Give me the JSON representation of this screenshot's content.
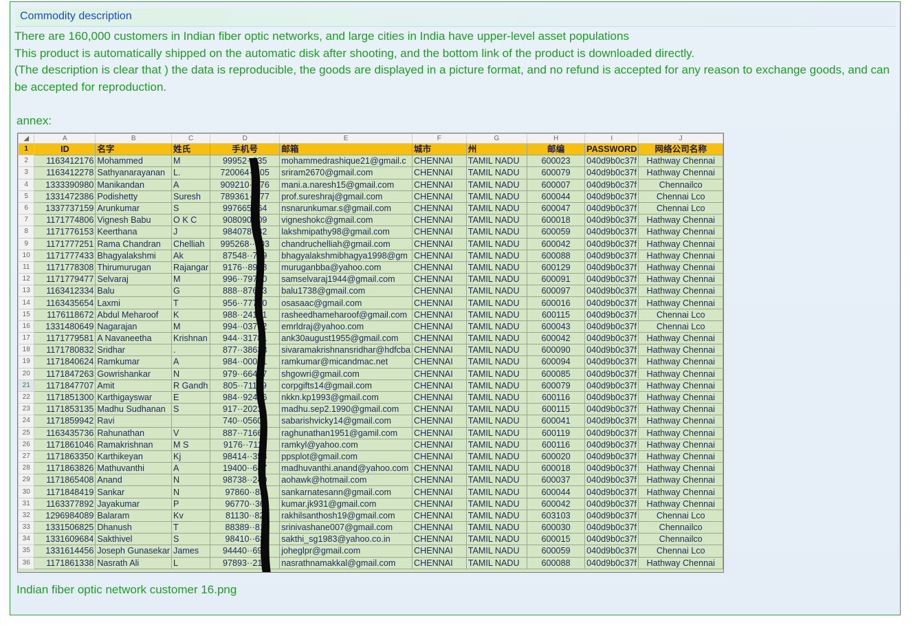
{
  "panel": {
    "title": "Commodity description",
    "description": [
      "There are 160,000 customers in Indian fiber optic networks, and large cities in India have upper-level asset populations",
      "This product is automatically shipped on the automatic disk after shooting, and the bottom link of the product is downloaded directly.",
      "(The description is clear that ) the data is reproducible, the goods are displayed in a picture format, and no refund is accepted for any reason to exchange goods, and can be accepted for reproduction."
    ],
    "annex_label": "annex:",
    "image_caption": "Indian fiber optic network customer 16.png"
  },
  "spreadsheet": {
    "corner": "◢",
    "column_letters": [
      "A",
      "B",
      "C",
      "D",
      "E",
      "F",
      "G",
      "H",
      "I",
      "J"
    ],
    "header_row_number": "1",
    "headers": [
      "ID",
      "名字",
      "姓氏",
      "手机号",
      "邮箱",
      "城市",
      "州",
      "邮编",
      "PASSWORD",
      "网络公司名称"
    ],
    "selected_row": "21",
    "rows": [
      [
        "2",
        "1163412176",
        "Mohammed",
        "M",
        "99952··035",
        "mohammedrashique21@gmail.c",
        "CHENNAI",
        "TAMIL NADU",
        "600023",
        "040d9b0c37f",
        "Hathway Chennai"
      ],
      [
        "3",
        "1163412278",
        "Sathyanarayanan",
        "L.",
        "720064··405",
        "sriram2670@gmail.com",
        "CHENNAI",
        "TAMIL NADU",
        "600079",
        "040d9b0c37f",
        "Hathway Chennai"
      ],
      [
        "4",
        "1333390980",
        "Manikandan",
        "A",
        "909210··976",
        "mani.a.naresh15@gmail.com",
        "CHENNAI",
        "TAMIL NADU",
        "600007",
        "040d9b0c37f",
        "Chennailco"
      ],
      [
        "5",
        "1331472386",
        "Podishetty",
        "Suresh",
        "789361··577",
        "prof.sureshraj@gmail.com",
        "CHENNAI",
        "TAMIL NADU",
        "600044",
        "040d9b0c37f",
        "Chennai Lco"
      ],
      [
        "6",
        "1337737159",
        "Arunkumar",
        "S",
        "997665··64",
        "nsnarunkumar.s@gmail.com",
        "CHENNAI",
        "TAMIL NADU",
        "600047",
        "040d9b0c37f",
        "Chennai Lco"
      ],
      [
        "7",
        "1171774806",
        "Vignesh Babu",
        "O K C",
        "908090··09",
        "vigneshokc@gmail.com",
        "CHENNAI",
        "TAMIL NADU",
        "600018",
        "040d9b0c37f",
        "Hathway Chennai"
      ],
      [
        "8",
        "1171776153",
        "Keerthana",
        "J",
        "984078··82",
        "lakshmipathy98@gmail.com",
        "CHENNAI",
        "TAMIL NADU",
        "600059",
        "040d9b0c37f",
        "Hathway Chennai"
      ],
      [
        "9",
        "1171777251",
        "Rama Chandran",
        "Chelliah",
        "995268··703",
        "chandruchelliah@gmail.com",
        "CHENNAI",
        "TAMIL NADU",
        "600042",
        "040d9b0c37f",
        "Hathway Chennai"
      ],
      [
        "10",
        "1171777433",
        "Bhagyalakshmi",
        "Ak",
        "87548··799",
        "bhagyalakshmibhagya1998@gm",
        "CHENNAI",
        "TAMIL NADU",
        "600088",
        "040d9b0c37f",
        "Hathway Chennai"
      ],
      [
        "11",
        "1171778308",
        "Thirumurugan",
        "Rajangar",
        "9176··8998",
        "muruganbba@yahoo.com",
        "CHENNAI",
        "TAMIL NADU",
        "600129",
        "040d9b0c37f",
        "Hathway Chennai"
      ],
      [
        "12",
        "1171779477",
        "Selvaraj",
        "M",
        "996··79710",
        "samselvaraj1944@gmail.com",
        "CHENNAI",
        "TAMIL NADU",
        "600091",
        "040d9b0c37f",
        "Hathway Chennai"
      ],
      [
        "13",
        "1163412334",
        "Balu",
        "G",
        "888··87683",
        "balu1738@gmail.com",
        "CHENNAI",
        "TAMIL NADU",
        "600097",
        "040d9b0c37f",
        "Hathway Chennai"
      ],
      [
        "14",
        "1163435654",
        "Laxmi",
        "T",
        "956··77730",
        "osasaac@gmail.com",
        "CHENNAI",
        "TAMIL NADU",
        "600016",
        "040d9b0c37f",
        "Hathway Chennai"
      ],
      [
        "15",
        "1176118672",
        "Abdul Meharoof",
        "K",
        "988··24161",
        "rasheedhameharoof@gmail.com",
        "CHENNAI",
        "TAMIL NADU",
        "600115",
        "040d9b0c37f",
        "Chennai Lco"
      ],
      [
        "16",
        "1331480649",
        "Nagarajan",
        "M",
        "994··03752",
        "emrldraj@yahoo.com",
        "CHENNAI",
        "TAMIL NADU",
        "600043",
        "040d9b0c37f",
        "Chennai Lco"
      ],
      [
        "17",
        "1171779581",
        "A Navaneetha",
        "Krishnan",
        "944··31781",
        "ank30august1955@gmail.com",
        "CHENNAI",
        "TAMIL NADU",
        "600042",
        "040d9b0c37f",
        "Hathway Chennai"
      ],
      [
        "18",
        "1171780832",
        "Sridhar",
        ".",
        "877··38633",
        "sivaramakrishnansridhar@hdfcba",
        "CHENNAI",
        "TAMIL NADU",
        "600090",
        "040d9b0c37f",
        "Hathway Chennai"
      ],
      [
        "19",
        "1171840624",
        "Ramkumar",
        "A",
        "984··00071",
        "ramkumar@micandmac.net",
        "CHENNAI",
        "TAMIL NADU",
        "600094",
        "040d9b0c37f",
        "Hathway Chennai"
      ],
      [
        "20",
        "1171847263",
        "Gowrishankar",
        "N",
        "979··66437",
        "shgowri@gmail.com",
        "CHENNAI",
        "TAMIL NADU",
        "600085",
        "040d9b0c37f",
        "Hathway Chennai"
      ],
      [
        "21",
        "1171847707",
        "Amit",
        "R Gandh",
        "805··71199",
        "corpgifts14@gmail.com",
        "CHENNAI",
        "TAMIL NADU",
        "600079",
        "040d9b0c37f",
        "Hathway Chennai"
      ],
      [
        "22",
        "1171851300",
        "Karthigayswar",
        "E",
        "984··92456",
        "nkkn.kp1993@gmail.com",
        "CHENNAI",
        "TAMIL NADU",
        "600116",
        "040d9b0c37f",
        "Hathway Chennai"
      ],
      [
        "23",
        "1171853135",
        "Madhu Sudhanan",
        "S",
        "917··20231",
        "madhu.sep2.1990@gmail.com",
        "CHENNAI",
        "TAMIL NADU",
        "600115",
        "040d9b0c37f",
        "Hathway Chennai"
      ],
      [
        "24",
        "1171859942",
        "Ravi",
        "",
        "740··05605",
        "sabarishvicky14@gmail.com",
        "CHENNAI",
        "TAMIL NADU",
        "600041",
        "040d9b0c37f",
        "Hathway Chennai"
      ],
      [
        "25",
        "1163435736",
        "Rahunathan",
        "V",
        "887··71666",
        "raghunathan1951@gamil.com",
        "CHENNAI",
        "TAMIL NADU",
        "600119",
        "040d9b0c37f",
        "Hathway Chennai"
      ],
      [
        "26",
        "1171861046",
        "Ramakrishnan",
        "M S",
        "9176··7111",
        "ramkyl@yahoo.com",
        "CHENNAI",
        "TAMIL NADU",
        "600116",
        "040d9b0c37f",
        "Hathway Chennai"
      ],
      [
        "27",
        "1171863350",
        "Karthikeyan",
        "Kj",
        "98414··358",
        "ppsplot@gmail.com",
        "CHENNAI",
        "TAMIL NADU",
        "600020",
        "040d9b0c37f",
        "Hathway Chennai"
      ],
      [
        "28",
        "1171863826",
        "Mathuvanthi",
        "A",
        "19400··647",
        "madhuvanthi.anand@yahoo.com",
        "CHENNAI",
        "TAMIL NADU",
        "600018",
        "040d9b0c37f",
        "Hathway Chennai"
      ],
      [
        "29",
        "1171865408",
        "Anand",
        "N",
        "98738··240",
        "aohawk@hotmail.com",
        "CHENNAI",
        "TAMIL NADU",
        "600037",
        "040d9b0c37f",
        "Hathway Chennai"
      ],
      [
        "30",
        "1171848419",
        "Sankar",
        "N",
        "97860··83",
        "sankarnatesann@gmail.com",
        "CHENNAI",
        "TAMIL NADU",
        "600044",
        "040d9b0c37f",
        "Hathway Chennai"
      ],
      [
        "31",
        "1163377892",
        "Jayakumar",
        "P",
        "96770··36",
        "kumar.jk931@gmail.com",
        "CHENNAI",
        "TAMIL NADU",
        "600042",
        "040d9b0c37f",
        "Hathway Chennai"
      ],
      [
        "32",
        "1296984089",
        "Balaram",
        "Kv",
        "81130··82",
        "rakhilsanthosh19@gmail.com",
        "CHENNAI",
        "TAMIL NADU",
        "603103",
        "040d9b0c37f",
        "Chennai Lco"
      ],
      [
        "33",
        "1331506825",
        "Dhanush",
        "T",
        "88389··81",
        "srinivashane007@gmail.com",
        "CHENNAI",
        "TAMIL NADU",
        "600030",
        "040d9b0c37f",
        "Chennailco"
      ],
      [
        "34",
        "1331609684",
        "Sakthivel",
        "S",
        "98410··63",
        "sakthi_sg1983@yahoo.co.in",
        "CHENNAI",
        "TAMIL NADU",
        "600015",
        "040d9b0c37f",
        "Chennailco"
      ],
      [
        "35",
        "1331614456",
        "Joseph Gunasekar",
        "James",
        "94440··697",
        "joheglpr@gmail.com",
        "CHENNAI",
        "TAMIL NADU",
        "600059",
        "040d9b0c37f",
        "Chennai Lco"
      ],
      [
        "36",
        "1171861338",
        "Nasrath Ali",
        "L",
        "97893··215",
        "nasrathnamakkal@gmail.com",
        "CHENNAI",
        "TAMIL NADU",
        "600088",
        "040d9b0c37f",
        "Hathway Chennai"
      ]
    ]
  },
  "colors": {
    "text_green": "#209b27",
    "title_blue": "#1a47d4",
    "header_yellow": "#f7bf10",
    "cell_green": "#d4e6c4",
    "border_green": "#3c9a4c",
    "redaction_black": "#0a0a0a"
  }
}
